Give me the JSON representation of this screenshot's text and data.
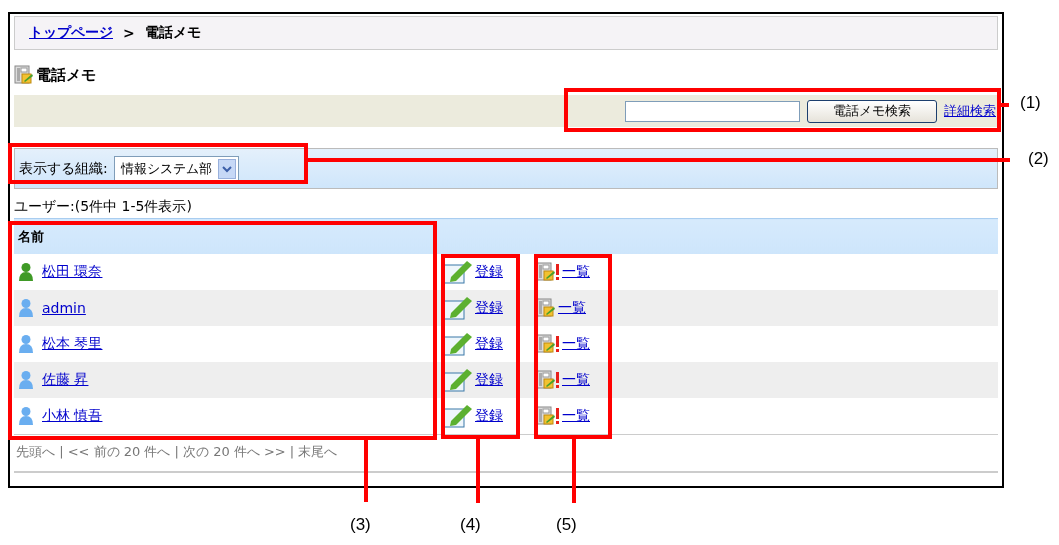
{
  "breadcrumb": {
    "link": "トップページ",
    "separator": ">",
    "current": "電話メモ"
  },
  "page_title": "電話メモ",
  "search": {
    "button": "電話メモ検索",
    "advanced_link": "詳細検索"
  },
  "organization": {
    "label": "表示する組織:",
    "value": "情報システム部"
  },
  "summary": "ユーザー:(5件中 1-5件表示)",
  "table": {
    "columns": [
      "名前"
    ],
    "rows": [
      {
        "name": "松田 環奈",
        "color": "#3f9a26",
        "register": "登録",
        "list": "一覧",
        "alert": true
      },
      {
        "name": "admin",
        "color": "#6aaef0",
        "register": "登録",
        "list": "一覧",
        "alert": false
      },
      {
        "name": "松本 琴里",
        "color": "#6aaef0",
        "register": "登録",
        "list": "一覧",
        "alert": true
      },
      {
        "name": "佐藤 昇",
        "color": "#6aaef0",
        "register": "登録",
        "list": "一覧",
        "alert": true
      },
      {
        "name": "小林 慎吾",
        "color": "#6aaef0",
        "register": "登録",
        "list": "一覧",
        "alert": true
      }
    ]
  },
  "pagination": "先頭へ | << 前の 20 件へ | 次の 20 件へ >> | 末尾へ",
  "callouts": [
    {
      "label": "(1)"
    },
    {
      "label": "(2)"
    },
    {
      "label": "(3)"
    },
    {
      "label": "(4)"
    },
    {
      "label": "(5)"
    }
  ]
}
